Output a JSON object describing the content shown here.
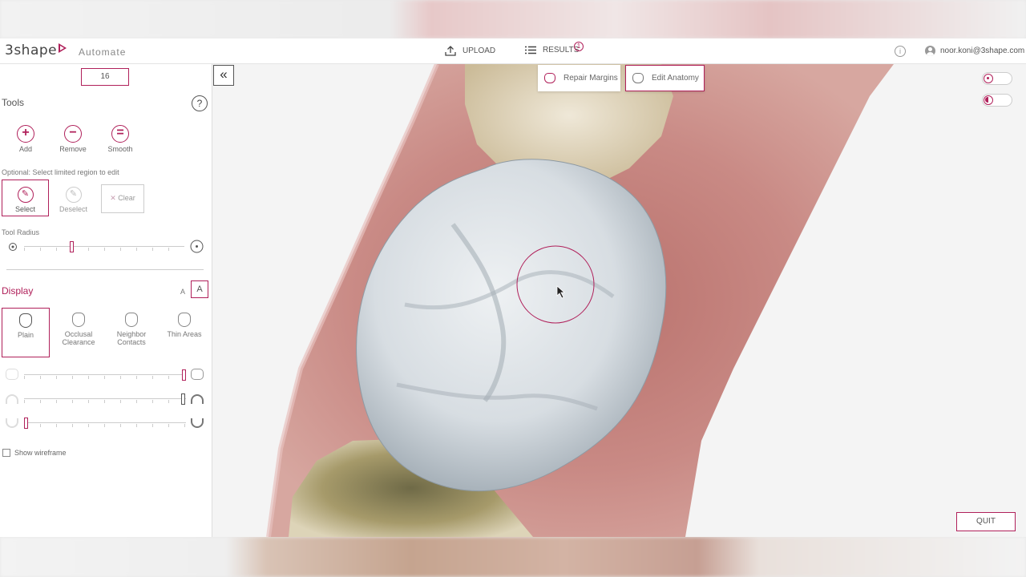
{
  "app": {
    "brand": "3shape",
    "name": "Automate"
  },
  "topbar": {
    "upload_label": "UPLOAD",
    "results_label": "RESULTS",
    "results_badge": "1",
    "user_email": "noor.koni@3shape.com"
  },
  "panel": {
    "tooth_number": "16",
    "tools_title": "Tools",
    "tools": [
      {
        "label": "Add",
        "icon": "add-icon"
      },
      {
        "label": "Remove",
        "icon": "remove-icon"
      },
      {
        "label": "Smooth",
        "icon": "smooth-icon"
      }
    ],
    "optional_hint": "Optional: Select limited region to edit",
    "select_label": "Select",
    "deselect_label": "Deselect",
    "clear_label": "Clear",
    "tool_radius_label": "Tool Radius",
    "tool_radius_level": 0.25,
    "display_title": "Display",
    "display_modes": [
      {
        "label_1": "Plain",
        "label_2": ""
      },
      {
        "label_1": "Occlusal",
        "label_2": "Clearance"
      },
      {
        "label_1": "Neighbor",
        "label_2": "Contacts"
      },
      {
        "label_1": "Thin Areas",
        "label_2": ""
      }
    ],
    "display_sliders": [
      1.0,
      0.98,
      0.02
    ],
    "show_wireframe_label": "Show wireframe"
  },
  "viewport": {
    "repair_margins_label": "Repair Margins",
    "edit_anatomy_label": "Edit Anatomy",
    "quit_label": "QUIT"
  },
  "colors": {
    "accent": "#b0205a",
    "gum": "#c98a85",
    "tooth": "#dfe4e8"
  }
}
